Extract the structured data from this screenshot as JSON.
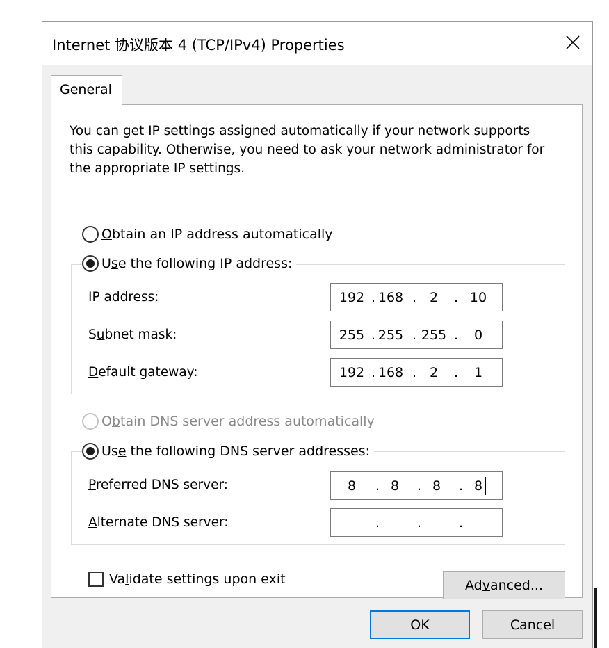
{
  "window": {
    "title": "Internet 协议版本 4 (TCP/IPv4) Properties"
  },
  "tabs": [
    {
      "label": "General",
      "selected": true
    }
  ],
  "intro_text": "You can get IP settings assigned automatically if your network supports this capability. Otherwise, you need to ask your network administrator for the appropriate IP settings.",
  "ip_section": {
    "auto": {
      "label_pre": "",
      "label_acc": "O",
      "label_post": "btain an IP address automatically",
      "selected": false
    },
    "manual": {
      "label_pre": "U",
      "label_acc": "s",
      "label_post": "e the following IP address:",
      "selected": true
    },
    "fields": [
      {
        "label_pre": "",
        "label_acc": "I",
        "label_post": "P address:",
        "octets": [
          "192",
          "168",
          "2",
          "10"
        ]
      },
      {
        "label_pre": "S",
        "label_acc": "u",
        "label_post": "bnet mask:",
        "octets": [
          "255",
          "255",
          "255",
          "0"
        ]
      },
      {
        "label_pre": "",
        "label_acc": "D",
        "label_post": "efault gateway:",
        "octets": [
          "192",
          "168",
          "2",
          "1"
        ]
      }
    ]
  },
  "dns_section": {
    "auto": {
      "label_pre": "O",
      "label_acc": "b",
      "label_post": "tain DNS server address automatically",
      "selected": false,
      "disabled": true
    },
    "manual": {
      "label_pre": "Us",
      "label_acc": "e",
      "label_post": " the following DNS server addresses:",
      "selected": true
    },
    "fields": [
      {
        "label_pre": "",
        "label_acc": "P",
        "label_post": "referred DNS server:",
        "octets": [
          "8",
          "8",
          "8",
          "8"
        ]
      },
      {
        "label_pre": "",
        "label_acc": "A",
        "label_post": "lternate DNS server:",
        "octets": [
          "",
          "",
          "",
          ""
        ]
      }
    ]
  },
  "validate": {
    "label_pre": "Va",
    "label_acc": "l",
    "label_post": "idate settings upon exit",
    "checked": false
  },
  "buttons": {
    "advanced": {
      "pre": "Ad",
      "acc": "v",
      "post": "anced..."
    },
    "ok": "OK",
    "cancel": "Cancel"
  }
}
